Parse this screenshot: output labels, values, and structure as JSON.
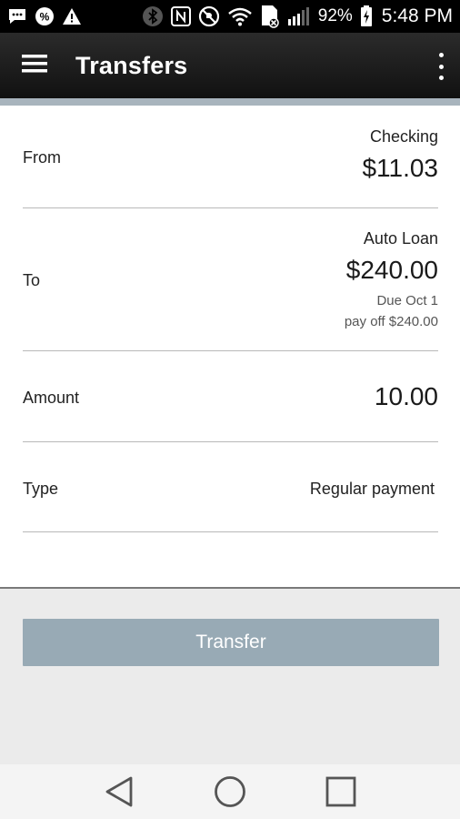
{
  "status_bar": {
    "battery_percent": "92%",
    "time": "5:48 PM",
    "left_icons": [
      "message-icon",
      "percent-icon",
      "warning-icon"
    ],
    "right_icons": [
      "bluetooth-icon",
      "nfc-icon",
      "do-not-disturb-icon",
      "wifi-icon",
      "sim-icon",
      "signal-icon",
      "battery-icon"
    ]
  },
  "app_bar": {
    "title": "Transfers",
    "menu_icon": "hamburger-menu-icon",
    "overflow_icon": "overflow-menu-icon"
  },
  "form": {
    "from": {
      "label": "From",
      "account_name": "Checking",
      "amount": "$11.03"
    },
    "to": {
      "label": "To",
      "account_name": "Auto Loan",
      "amount": "$240.00",
      "due": "Due Oct 1",
      "payoff": "pay off $240.00"
    },
    "amount": {
      "label": "Amount",
      "value": "10.00"
    },
    "type": {
      "label": "Type",
      "value": "Regular payment"
    }
  },
  "transfer_button": {
    "label": "Transfer"
  },
  "nav_bar": {
    "icons": [
      "back-icon",
      "home-icon",
      "recents-icon"
    ]
  },
  "colors": {
    "app_bar": "#1c1c1c",
    "accent_shade": "#a8b4bd",
    "button": "#98aab5",
    "background": "#ebebeb"
  }
}
